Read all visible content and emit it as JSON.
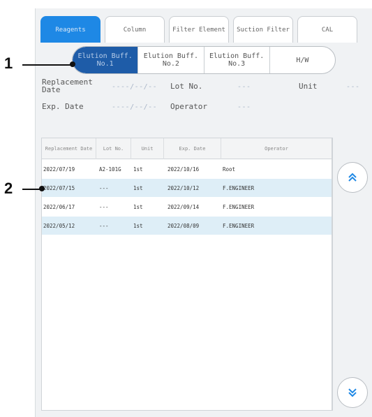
{
  "tabs": [
    {
      "label": "Reagents",
      "active": true
    },
    {
      "label": "Column",
      "active": false
    },
    {
      "label": "Filter Element",
      "active": false
    },
    {
      "label": "Suction Filter",
      "active": false
    },
    {
      "label": "CAL",
      "active": false
    }
  ],
  "segments": [
    {
      "label": "Elution Buff.\nNo.1",
      "active": true
    },
    {
      "label": "Elution Buff.\nNo.2",
      "active": false
    },
    {
      "label": "Elution Buff.\nNo.3",
      "active": false
    },
    {
      "label": "H/W",
      "active": false
    }
  ],
  "info": {
    "replacement_date_label": "Replacement\nDate",
    "replacement_date_value": "----/--/--",
    "lot_no_label": "Lot No.",
    "lot_no_value": "---",
    "unit_label": "Unit",
    "unit_value": "---",
    "exp_date_label": "Exp. Date",
    "exp_date_value": "----/--/--",
    "operator_label": "Operator",
    "operator_value": "---"
  },
  "table": {
    "headers": [
      "Replacement Date",
      "Lot No.",
      "Unit",
      "Exp. Date",
      "Operator"
    ],
    "rows": [
      [
        "2022/07/19",
        "A2-101G",
        "1st",
        "2022/10/16",
        "Root"
      ],
      [
        "2022/07/15",
        "---",
        "1st",
        "2022/10/12",
        "F.ENGINEER"
      ],
      [
        "2022/06/17",
        "---",
        "1st",
        "2022/09/14",
        "F.ENGINEER"
      ],
      [
        "2022/05/12",
        "---",
        "1st",
        "2022/08/09",
        "F.ENGINEER"
      ]
    ]
  },
  "callouts": {
    "one": "1",
    "two": "2"
  },
  "icons": {
    "scroll_up": "double-chevron-up-icon",
    "scroll_down": "double-chevron-down-icon"
  },
  "colors": {
    "accent": "#1e88e5",
    "segment_active": "#1e5ca8",
    "row_highlight": "#deeef7"
  }
}
